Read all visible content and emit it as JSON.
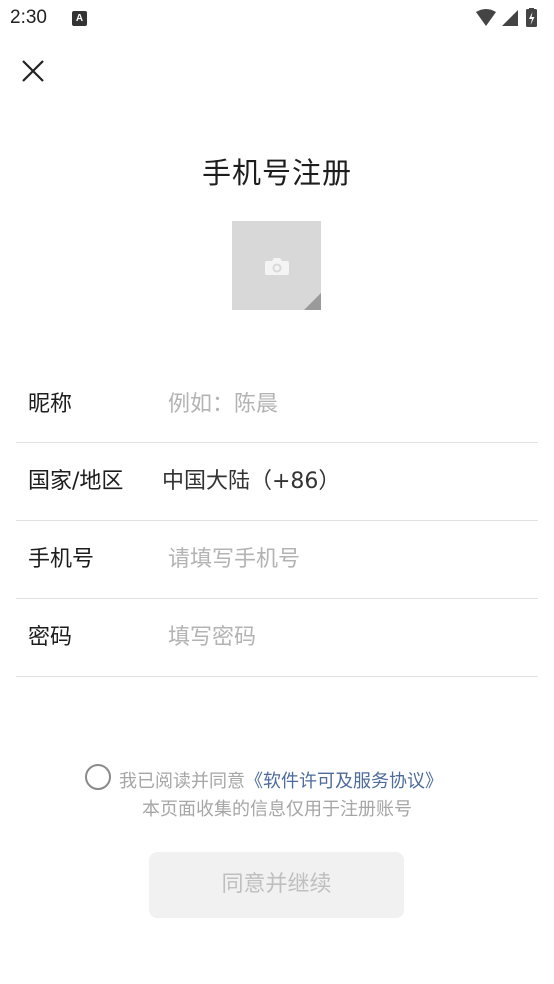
{
  "status_bar": {
    "time": "2:30",
    "app_icon": "A",
    "icons": [
      "wifi-icon",
      "signal-icon",
      "battery-charging-icon"
    ]
  },
  "header": {
    "close_icon": "close-icon",
    "title": "手机号注册"
  },
  "avatar": {
    "icon": "camera-icon"
  },
  "form": {
    "nickname": {
      "label": "昵称",
      "placeholder": "例如：陈晨"
    },
    "region": {
      "label": "国家/地区",
      "value": "中国大陆（+86）"
    },
    "phone": {
      "label": "手机号",
      "placeholder": "请填写手机号"
    },
    "password": {
      "label": "密码",
      "placeholder": "填写密码"
    }
  },
  "agreement": {
    "prefix": "我已阅读并同意",
    "link": "《软件许可及服务协议》",
    "note": "本页面收集的信息仅用于注册账号"
  },
  "continue_button": {
    "label": "同意并继续",
    "enabled": false
  },
  "colors": {
    "link": "#4d6b9c",
    "placeholder": "#b3b3b3",
    "button_disabled_bg": "#f1f1f1",
    "avatar_bg": "#d8d8d8"
  }
}
